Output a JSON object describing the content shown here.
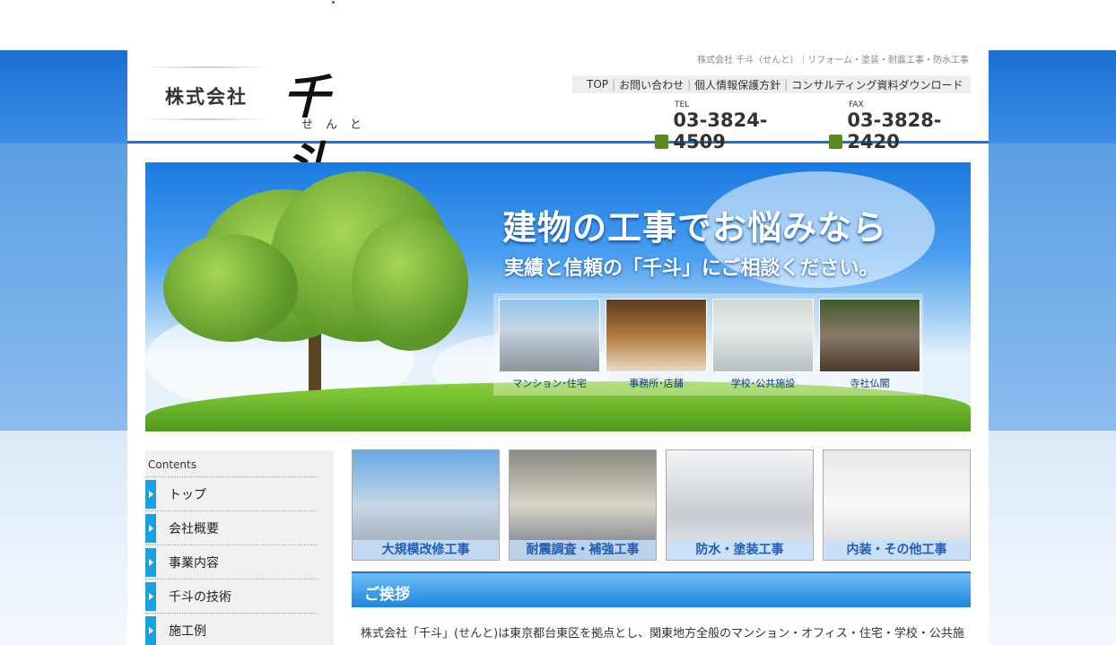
{
  "header": {
    "company_kk": "株式会社",
    "brand": "千斗",
    "brand_ruby": "せんと",
    "tagline": "株式会社 千斗（せんと）｜リフォーム・塗装・耐震工事・防水工事",
    "nav": [
      "TOP",
      "お問い合わせ",
      "個人情報保護方針",
      "コンサルティング資料ダウンロード"
    ],
    "tel_label": "TEL",
    "tel": "03-3824-4509",
    "fax_label": "FAX",
    "fax": "03-3828-2420"
  },
  "hero": {
    "headline": "建物の工事でお悩みなら",
    "subline": "実績と信頼の「千斗」にご相談ください。",
    "categories": [
      "マンション･住宅",
      "事務所･店舗",
      "学校･公共施設",
      "寺社仏閣"
    ]
  },
  "sidebar": {
    "heading": "Contents",
    "items": [
      "トップ",
      "会社概要",
      "事業内容",
      "千斗の技術",
      "施工例"
    ]
  },
  "services": [
    "大規模改修工事",
    "耐震調査・補強工事",
    "防水・塗装工事",
    "内装・その他工事"
  ],
  "greeting": {
    "title": "ご挨拶",
    "text": "株式会社「千斗」(せんと)は東京都台東区を拠点とし、関東地方全般のマンション・オフィス・住宅・学校・公共施"
  }
}
